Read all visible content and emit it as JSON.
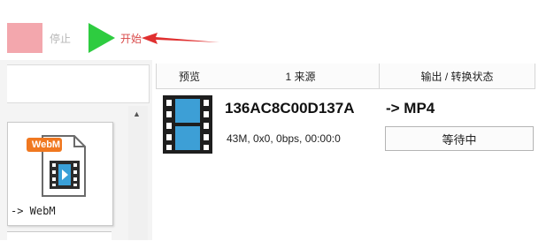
{
  "toolbar": {
    "stop_label": "停止",
    "start_label": "开始",
    "stop_color": "#f3a7ad",
    "start_color": "#2ecc40",
    "annotation_arrow_color": "#e03030"
  },
  "left_panel": {
    "format_card": {
      "badge_text": "WebM",
      "label": "-> WebM",
      "icon": "webm-file-icon"
    }
  },
  "table": {
    "columns": [
      "预览",
      "1 来源",
      "输出 / 转换状态"
    ],
    "rows": [
      {
        "thumbnail_icon": "film-strip-icon",
        "source_name": "136AC8C00D137A",
        "source_info": "43M, 0x0, 0bps, 00:00:0",
        "output_format": "-> MP4",
        "status": "等待中"
      }
    ]
  }
}
